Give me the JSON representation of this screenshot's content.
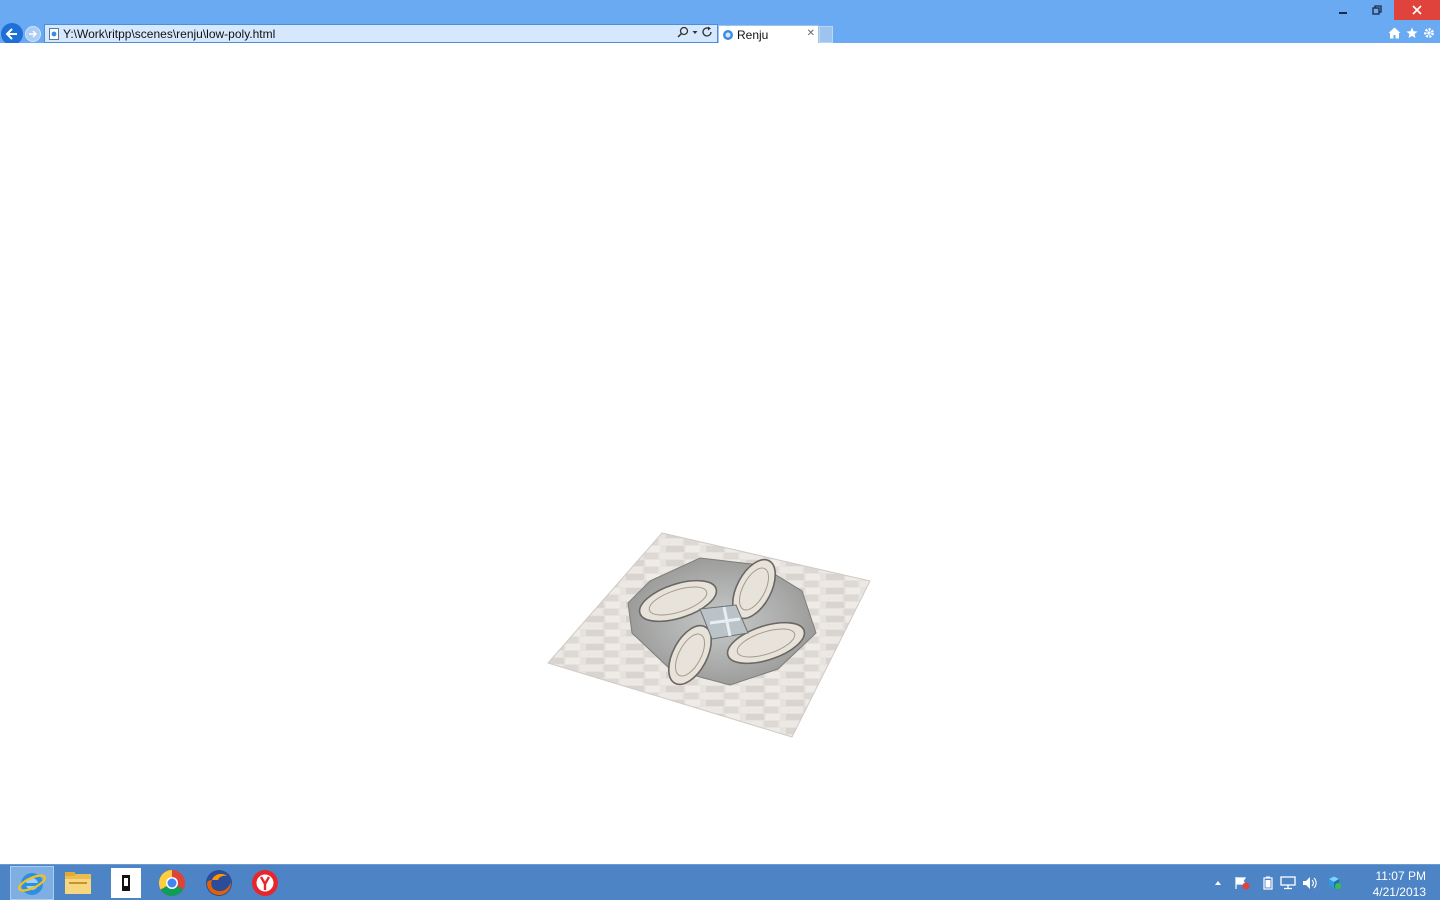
{
  "window": {
    "minimize_icon": "minimize-icon",
    "restore_icon": "restore-icon",
    "close_icon": "close-icon"
  },
  "address_bar": {
    "url": "Y:\\Work\\ritpp\\scenes\\renju\\low-poly.html"
  },
  "tabs": [
    {
      "label": "Renju",
      "active": true
    }
  ],
  "toolbar_icons": [
    "home-icon",
    "favorites-star-icon",
    "settings-gear-icon"
  ],
  "taskbar": {
    "pinned": [
      "internet-explorer",
      "file-explorer",
      "app-black-white",
      "chrome",
      "firefox",
      "yandex-browser"
    ],
    "clock_time": "11:07 PM",
    "clock_date": "4/21/2013"
  },
  "colors": {
    "titlebar": "#6aaaf2",
    "taskbar": "#4d84c6",
    "close_button": "#e0433b",
    "page_background": "#ffffff"
  }
}
